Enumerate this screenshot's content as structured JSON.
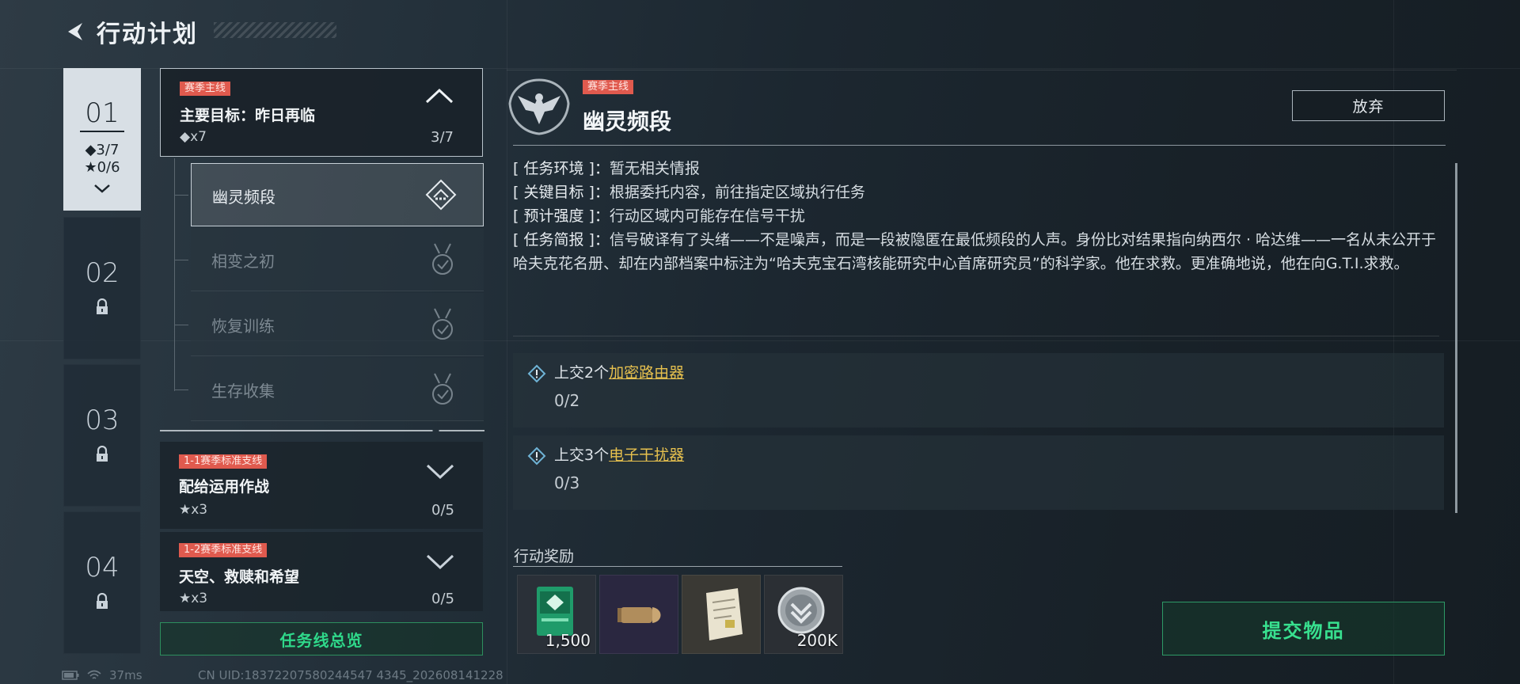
{
  "header": {
    "title": "行动计划"
  },
  "chapters": [
    {
      "num": "01",
      "diamond": "◆3/7",
      "star": "★0/6"
    },
    {
      "num": "02"
    },
    {
      "num": "03"
    },
    {
      "num": "04"
    }
  ],
  "main_quest": {
    "tag": "赛季主线",
    "title": "主要目标：昨日再临",
    "reward": "◆x7",
    "progress": "3/7"
  },
  "subtasks": [
    {
      "label": "幽灵频段"
    },
    {
      "label": "相变之初"
    },
    {
      "label": "恢复训练"
    },
    {
      "label": "生存收集"
    }
  ],
  "side_quests": [
    {
      "tag": "1-1赛季标准支线",
      "title": "配给运用作战",
      "reward": "★x3",
      "progress": "0/5"
    },
    {
      "tag": "1-2赛季标准支线",
      "title": "天空、救赎和希望",
      "reward": "★x3",
      "progress": "0/5"
    }
  ],
  "overview_button": "任务线总览",
  "detail": {
    "tag": "赛季主线",
    "title": "幽灵频段",
    "abandon": "放弃",
    "info": [
      {
        "key": "[ 任务环境 ]：",
        "value": "暂无相关情报"
      },
      {
        "key": "[ 关键目标 ]：",
        "value": "根据委托内容，前往指定区域执行任务"
      },
      {
        "key": "[ 预计强度 ]：",
        "value": "行动区域内可能存在信号干扰"
      },
      {
        "key": "[ 任务简报 ]：",
        "value": "信号破译有了头绪——不是噪声，而是一段被隐匿在最低频段的人声。身份比对结果指向纳西尔 · 哈达维——一名从未公开于哈夫克花名册、却在内部档案中标注为“哈夫克宝石湾核能研究中心首席研究员”的科学家。他在求救。更准确地说，他在向G.T.I.求救。"
      }
    ],
    "objectives": [
      {
        "prefix": "上交2个",
        "item": "加密路由器",
        "count": "0/2"
      },
      {
        "prefix": "上交3个",
        "item": "电子干扰器",
        "count": "0/3"
      }
    ],
    "reward_title": "行动奖励",
    "rewards": [
      {
        "name": "green-card-item",
        "qty": "1,500"
      },
      {
        "name": "bullet-item",
        "qty": ""
      },
      {
        "name": "document-item",
        "qty": ""
      },
      {
        "name": "coin-item",
        "qty": "200K"
      }
    ],
    "submit": "提交物品"
  },
  "status": {
    "ping": "37ms",
    "uid": "CN UID:18372207580244547 4345_202608141228"
  },
  "colors": {
    "accent_green": "#38e08f",
    "tag_red": "#e05a4e",
    "link_yellow": "#e6c04e"
  }
}
